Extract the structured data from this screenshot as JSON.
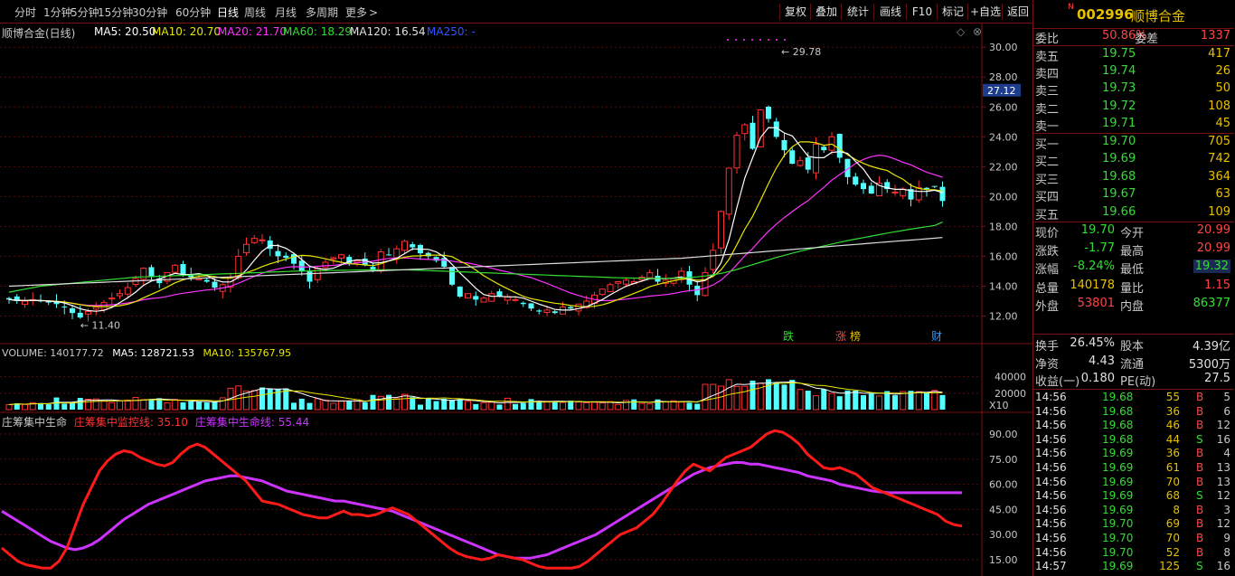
{
  "toolbar": {
    "periods": [
      "分时",
      "1分钟",
      "5分钟",
      "15分钟",
      "30分钟",
      "60分钟",
      "日线",
      "周线",
      "月线",
      "多周期",
      "更多"
    ],
    "active": "日线",
    "buttons": [
      "复权",
      "叠加",
      "统计",
      "画线",
      "F10",
      "标记",
      "+自选",
      "返回"
    ]
  },
  "main": {
    "title": "顺博合金(日线)",
    "ma": [
      {
        "label": "MA5: 20.50",
        "color": "#ffffff"
      },
      {
        "label": "MA10: 20.70",
        "color": "#e6e600"
      },
      {
        "label": "MA20: 21.70",
        "color": "#ff33ff"
      },
      {
        "label": "MA60: 18.29",
        "color": "#33dd33"
      },
      {
        "label": "MA120: 16.54",
        "color": "#e0e0e0"
      },
      {
        "label": "MA250: -",
        "color": "#3355ff"
      }
    ],
    "high_label": "29.78",
    "low_label": "11.40",
    "current_price_tag": "27.12",
    "markers": [
      {
        "text": "跌",
        "color": "#33dd33"
      },
      {
        "text": "涨",
        "color": "#ff4444"
      },
      {
        "text": "榜",
        "color": "#e6c000"
      },
      {
        "text": "财",
        "color": "#3399ff"
      }
    ],
    "price_ticks": [
      "30.00",
      "28.00",
      "26.00",
      "24.00",
      "22.00",
      "20.00",
      "18.00",
      "16.00",
      "14.00",
      "12.00"
    ]
  },
  "volume": {
    "title": "VOLUME: 140177.72",
    "ma5": "MA5: 128721.53",
    "ma10": "MA10: 135767.95",
    "ticks": [
      "40000",
      "20000"
    ],
    "unit": "X10"
  },
  "indicator": {
    "title": "庄筹集中生命",
    "line1": "庄筹集中监控线: 35.10",
    "line2": "庄筹集中生命线: 55.44",
    "ticks": [
      "90.00",
      "75.00",
      "60.00",
      "45.00",
      "30.00",
      "15.00"
    ]
  },
  "quote": {
    "flag": "N",
    "code": "002996",
    "name": "顺博合金",
    "weibi_label": "委比",
    "weibi": "50.86%",
    "weicha_label": "委差",
    "weicha": "1337",
    "asks": [
      {
        "label": "卖五",
        "price": "19.75",
        "vol": "417"
      },
      {
        "label": "卖四",
        "price": "19.74",
        "vol": "26"
      },
      {
        "label": "卖三",
        "price": "19.73",
        "vol": "50"
      },
      {
        "label": "卖二",
        "price": "19.72",
        "vol": "108"
      },
      {
        "label": "卖一",
        "price": "19.71",
        "vol": "45"
      }
    ],
    "bids": [
      {
        "label": "买一",
        "price": "19.70",
        "vol": "705"
      },
      {
        "label": "买二",
        "price": "19.69",
        "vol": "742"
      },
      {
        "label": "买三",
        "price": "19.68",
        "vol": "364"
      },
      {
        "label": "买四",
        "price": "19.67",
        "vol": "63"
      },
      {
        "label": "买五",
        "price": "19.66",
        "vol": "109"
      }
    ],
    "stats": [
      {
        "l1": "现价",
        "v1": "19.70",
        "c1": "#33dd33",
        "l2": "今开",
        "v2": "20.99",
        "c2": "#ff4444"
      },
      {
        "l1": "涨跌",
        "v1": "-1.77",
        "c1": "#33dd33",
        "l2": "最高",
        "v2": "20.99",
        "c2": "#ff4444"
      },
      {
        "l1": "涨幅",
        "v1": "-8.24%",
        "c1": "#33dd33",
        "l2": "最低",
        "v2": "19.32",
        "c2": "#33dd33"
      },
      {
        "l1": "总量",
        "v1": "140178",
        "c1": "#e6c000",
        "l2": "量比",
        "v2": "1.15",
        "c2": "#ff4444"
      },
      {
        "l1": "外盘",
        "v1": "53801",
        "c1": "#ff4444",
        "l2": "内盘",
        "v2": "86377",
        "c2": "#33dd33"
      }
    ],
    "stats2": [
      {
        "l1": "换手",
        "v1": "26.45%",
        "l2": "股本",
        "v2": "4.39亿"
      },
      {
        "l1": "净资",
        "v1": "4.43",
        "l2": "流通",
        "v2": "5300万"
      },
      {
        "l1": "收益(一)",
        "v1": "0.180",
        "l2": "PE(动)",
        "v2": "27.5"
      }
    ],
    "trades": [
      {
        "t": "14:56",
        "p": "19.68",
        "v": "55",
        "s": "B",
        "n": "5"
      },
      {
        "t": "14:56",
        "p": "19.68",
        "v": "36",
        "s": "B",
        "n": "6"
      },
      {
        "t": "14:56",
        "p": "19.68",
        "v": "46",
        "s": "B",
        "n": "12"
      },
      {
        "t": "14:56",
        "p": "19.68",
        "v": "44",
        "s": "S",
        "n": "16"
      },
      {
        "t": "14:56",
        "p": "19.69",
        "v": "36",
        "s": "B",
        "n": "4"
      },
      {
        "t": "14:56",
        "p": "19.69",
        "v": "61",
        "s": "B",
        "n": "13"
      },
      {
        "t": "14:56",
        "p": "19.69",
        "v": "70",
        "s": "B",
        "n": "13"
      },
      {
        "t": "14:56",
        "p": "19.69",
        "v": "68",
        "s": "S",
        "n": "12"
      },
      {
        "t": "14:56",
        "p": "19.69",
        "v": "8",
        "s": "B",
        "n": "3"
      },
      {
        "t": "14:56",
        "p": "19.70",
        "v": "69",
        "s": "B",
        "n": "12"
      },
      {
        "t": "14:56",
        "p": "19.70",
        "v": "70",
        "s": "B",
        "n": "9"
      },
      {
        "t": "14:56",
        "p": "19.70",
        "v": "52",
        "s": "B",
        "n": "8"
      },
      {
        "t": "14:57",
        "p": "19.69",
        "v": "125",
        "s": "S",
        "n": "16"
      }
    ]
  },
  "chart_data": {
    "type": "candlestick",
    "ylim": [
      11,
      30.8
    ],
    "close": [
      13.1,
      13.0,
      13.0,
      13.1,
      13.0,
      12.9,
      12.8,
      12.6,
      12.2,
      11.9,
      12.3,
      12.6,
      12.9,
      13.2,
      13.5,
      13.9,
      14.5,
      15.2,
      14.6,
      14.2,
      14.9,
      15.4,
      14.8,
      14.6,
      14.5,
      14.3,
      13.9,
      14.1,
      14.6,
      16.0,
      16.8,
      17.2,
      17.1,
      16.5,
      16.0,
      15.9,
      15.5,
      15.0,
      14.3,
      15.2,
      15.6,
      15.9,
      16.1,
      15.5,
      15.7,
      15.4,
      15.0,
      16.3,
      16.1,
      16.5,
      17.0,
      16.6,
      16.2,
      16.0,
      15.7,
      15.3,
      14.1,
      13.3,
      13.5,
      13.1,
      13.2,
      13.5,
      13.3,
      13.3,
      13.1,
      12.8,
      12.5,
      12.3,
      12.4,
      12.2,
      12.6,
      12.5,
      12.8,
      13.0,
      13.4,
      13.8,
      14.1,
      14.3,
      14.4,
      14.3,
      14.6,
      14.9,
      14.3,
      14.4,
      14.5,
      15.0,
      14.1,
      13.4,
      14.9,
      16.4,
      19.0,
      21.9,
      24.1,
      24.8,
      23.2,
      25.8,
      25.2,
      24.0,
      23.1,
      22.2,
      22.4,
      21.8,
      23.5,
      23.1,
      24.0,
      22.6,
      21.3,
      20.8,
      20.5,
      20.2,
      20.9,
      20.5,
      20.3,
      20.5,
      19.8,
      20.6,
      20.5,
      20.7,
      19.7
    ],
    "ma60": [
      13.6,
      13.7,
      13.8,
      13.9,
      14.0,
      14.05,
      14.1,
      14.15,
      14.2,
      14.25,
      14.3,
      14.35,
      14.4,
      14.45,
      14.5,
      14.55,
      14.6,
      14.62,
      14.64,
      14.66,
      14.68,
      14.7,
      14.72,
      14.74,
      14.76,
      14.78,
      14.8,
      14.82,
      14.84,
      14.86,
      14.88,
      14.9,
      14.92,
      14.94,
      14.96,
      14.98,
      15.0,
      15.01,
      15.02,
      15.03,
      15.04,
      15.05,
      15.06,
      15.07,
      15.08,
      15.09,
      15.1,
      15.1,
      15.1,
      15.1,
      15.1,
      15.08,
      15.06,
      15.04,
      15.02,
      15.0,
      14.98,
      14.96,
      14.94,
      14.92,
      14.9,
      14.88,
      14.86,
      14.84,
      14.82,
      14.8,
      14.78,
      14.76,
      14.74,
      14.72,
      14.7,
      14.68,
      14.66,
      14.64,
      14.62,
      14.6,
      14.58,
      14.56,
      14.55,
      14.54,
      14.53,
      14.52,
      14.52,
      14.52,
      14.53,
      14.55,
      14.58,
      14.62,
      14.68,
      14.76,
      14.86,
      14.98,
      15.12,
      15.28,
      15.44,
      15.6,
      15.76,
      15.92,
      16.06,
      16.2,
      16.34,
      16.46,
      16.58,
      16.7,
      16.82,
      16.94,
      17.05,
      17.15,
      17.25,
      17.35,
      17.45,
      17.55,
      17.64,
      17.73,
      17.82,
      17.9,
      17.98,
      18.06,
      18.29
    ]
  }
}
